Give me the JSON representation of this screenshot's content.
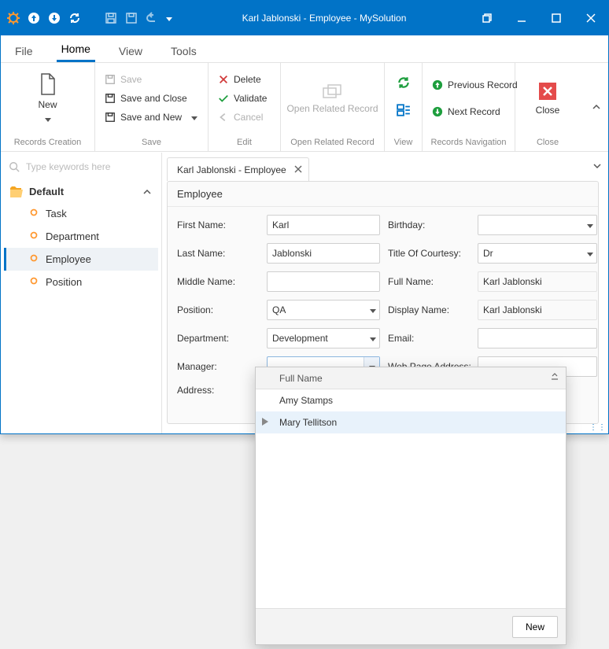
{
  "window": {
    "title": "Karl Jablonski - Employee - MySolution"
  },
  "menubar": {
    "active_index": 1,
    "items": [
      "File",
      "Home",
      "View",
      "Tools"
    ]
  },
  "ribbon": {
    "records": {
      "new": "New",
      "label": "Records Creation"
    },
    "save": {
      "save": "Save",
      "save_close": "Save and Close",
      "save_new": "Save and New",
      "label": "Save"
    },
    "edit": {
      "delete": "Delete",
      "validate": "Validate",
      "cancel": "Cancel",
      "label": "Edit"
    },
    "open": {
      "big": "Open Related Record",
      "label": "Open Related Record"
    },
    "view": {
      "label": "View"
    },
    "nav": {
      "prev": "Previous Record",
      "next": "Next Record",
      "label": "Records Navigation"
    },
    "close": {
      "close": "Close",
      "label": "Close"
    }
  },
  "sidebar": {
    "search_placeholder": "Type keywords here",
    "group": "Default",
    "items": [
      "Task",
      "Department",
      "Employee",
      "Position"
    ],
    "selected_index": 2
  },
  "tab": {
    "title": "Karl Jablonski - Employee"
  },
  "form": {
    "header": "Employee",
    "first_name": {
      "label": "First Name:",
      "value": "Karl"
    },
    "last_name": {
      "label": "Last Name:",
      "value": "Jablonski"
    },
    "middle_name": {
      "label": "Middle Name:",
      "value": ""
    },
    "position": {
      "label": "Position:",
      "value": "QA"
    },
    "department": {
      "label": "Department:",
      "value": "Development"
    },
    "manager": {
      "label": "Manager:",
      "value": ""
    },
    "address": {
      "label": "Address:"
    },
    "birthday": {
      "label": "Birthday:",
      "value": ""
    },
    "title_of_courtesy": {
      "label": "Title Of Courtesy:",
      "value": "Dr"
    },
    "full_name": {
      "label": "Full Name:",
      "value": "Karl Jablonski"
    },
    "display_name": {
      "label": "Display Name:",
      "value": "Karl Jablonski"
    },
    "email": {
      "label": "Email:",
      "value": ""
    },
    "web": {
      "label": "Web Page Address:",
      "value": ""
    }
  },
  "popup": {
    "column": "Full Name",
    "rows": [
      "Amy Stamps",
      "Mary Tellitson"
    ],
    "selected_index": 1,
    "new_button": "New"
  }
}
